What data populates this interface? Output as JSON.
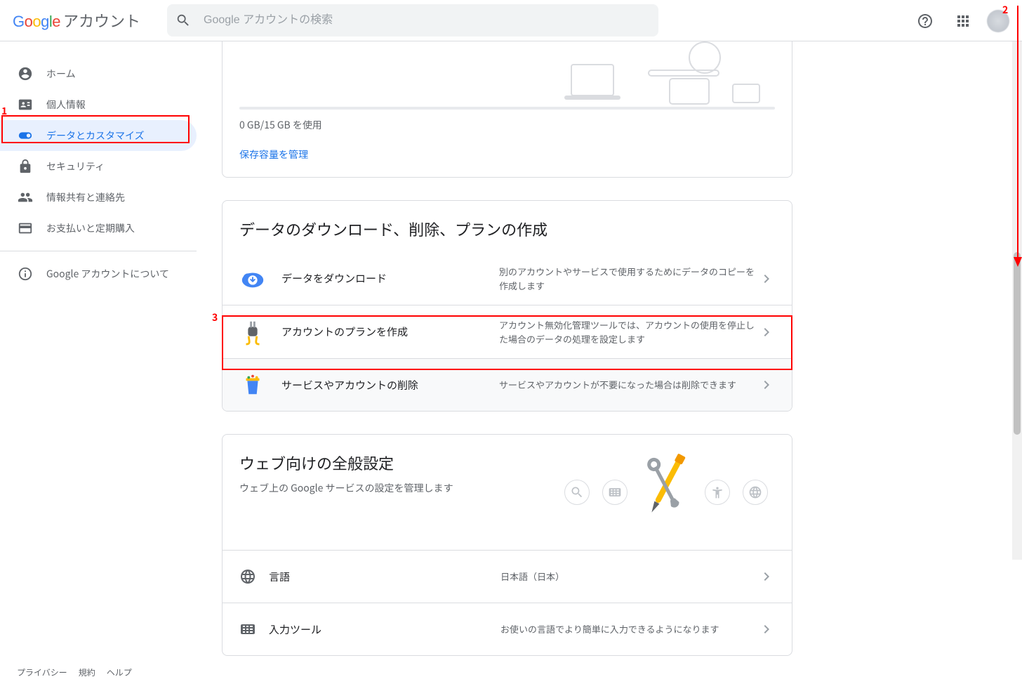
{
  "header": {
    "product": "アカウント",
    "search_placeholder": "Google アカウントの検索"
  },
  "sidebar": {
    "items": [
      {
        "label": "ホーム"
      },
      {
        "label": "個人情報"
      },
      {
        "label": "データとカスタマイズ"
      },
      {
        "label": "セキュリティ"
      },
      {
        "label": "情報共有と連絡先"
      },
      {
        "label": "お支払いと定期購入"
      }
    ],
    "about": "Google アカウントについて",
    "footer": {
      "privacy": "プライバシー",
      "terms": "規約",
      "help": "ヘルプ"
    }
  },
  "storage": {
    "usage_label": "0 GB/15 GB を使用",
    "manage_link": "保存容量を管理"
  },
  "data_section": {
    "title": "データのダウンロード、削除、プランの作成",
    "rows": [
      {
        "title": "データをダウンロード",
        "desc": "別のアカウントやサービスで使用するためにデータのコピーを作成します"
      },
      {
        "title": "アカウントのプランを作成",
        "desc": "アカウント無効化管理ツールでは、アカウントの使用を停止した場合のデータの処理を設定します"
      },
      {
        "title": "サービスやアカウントの削除",
        "desc": "サービスやアカウントが不要になった場合は削除できます"
      }
    ]
  },
  "web_section": {
    "title": "ウェブ向けの全般設定",
    "subtitle": "ウェブ上の Google サービスの設定を管理します",
    "rows": [
      {
        "title": "言語",
        "desc": "日本語（日本）"
      },
      {
        "title": "入力ツール",
        "desc": "お使いの言語でより簡単に入力できるようになります"
      }
    ]
  },
  "annotations": {
    "n1": "1",
    "n2": "2",
    "n3": "3"
  }
}
